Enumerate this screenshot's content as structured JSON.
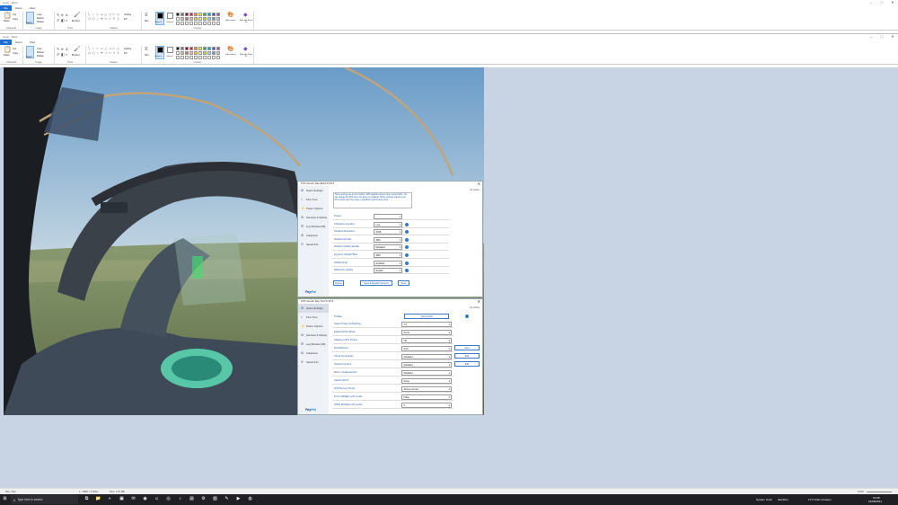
{
  "window1": {
    "title": "Copy - Paint",
    "tabs": [
      "File",
      "Home",
      "View"
    ]
  },
  "window2": {
    "title": "Copy - Paint",
    "tabs": [
      "File",
      "Home",
      "View"
    ]
  },
  "ribbon": {
    "groups": [
      "Clipboard",
      "Image",
      "Tools",
      "Shapes",
      "Colours"
    ],
    "clipboard": {
      "paste": "Paste",
      "cut": "Cut",
      "copy": "Copy"
    },
    "image": {
      "select": "Select",
      "crop": "Crop",
      "resize": "Resize",
      "rotate": "Rotate"
    },
    "tools": {
      "brushes": "Brushes"
    },
    "shapes": {
      "outline": "Outline",
      "fill": "Fill"
    },
    "size": "Size",
    "colour1": "Colour 1",
    "colour2": "Colour 2",
    "edit_colours": "Edit colours",
    "edit_with_paint3d": "Edit with Paint 3D",
    "palette": [
      "#000000",
      "#7f7f7f",
      "#880015",
      "#ed1c24",
      "#ff7f27",
      "#fff200",
      "#22b14c",
      "#00a2e8",
      "#3f48cc",
      "#a349a4",
      "#ffffff",
      "#c3c3c3",
      "#b97a57",
      "#ffaec9",
      "#ffc90e",
      "#efe4b0",
      "#b5e61d",
      "#99d9ea",
      "#7092be",
      "#c8bfe7"
    ]
  },
  "dialog1": {
    "title": "FPS Vendor Ray Build 5715.5",
    "close": "✕",
    "sidebar": [
      "Game Settings",
      "Fine Tune",
      "Power Options",
      "Services & Startup",
      "Log Window (F8)",
      "Advanced",
      "Saved Info"
    ],
    "description": "These settings are for the Nvidia / AMD graphics drivers when using DLSS. You can change the FPS when the game is restarted. Higher settings require more GPU power and may cause a significant performance drop.",
    "version_text": "By Asticle",
    "rows": [
      {
        "label": "Preset",
        "value": ""
      },
      {
        "label": "Character Caustics",
        "value": "Low"
      },
      {
        "label": "Shadow Resolution",
        "value": "2048"
      },
      {
        "label": "Shadow Render",
        "value": "SBC"
      },
      {
        "label": "Shadow Quality Render",
        "value": "Disabled"
      },
      {
        "label": "Dynamic Shader Bias",
        "value": "SBC"
      },
      {
        "label": "Shadowmap",
        "value": "Enabled"
      },
      {
        "label": "Reflection Quality",
        "value": "Enable"
      }
    ],
    "buttons": [
      "Delete",
      "Save & Restart Screens",
      "Save"
    ],
    "paypal_a": "Pay",
    "paypal_b": "Pal"
  },
  "dialog2": {
    "title": "FPS Vendor Ray Tool 5715.5",
    "close": "✕",
    "sidebar": [
      "Game Settings",
      "Fine Tune",
      "Power Options",
      "Services & Startup",
      "Log Window (F8)",
      "Advanced",
      "Saved Info"
    ],
    "version_text": "By Asticle",
    "top_row": {
      "label": "Profiles",
      "button": "View & Edit"
    },
    "rows": [
      {
        "label": "Select Power Scheduling",
        "value": "1.0"
      },
      {
        "label": "Default DX12 Mode",
        "value": "60 Hz"
      },
      {
        "label": "Adaptive GPU Priority",
        "value": "Off"
      },
      {
        "label": "Full Multicore",
        "value": "0.00"
      },
      {
        "label": "Cloud Commands",
        "value": "Disabled"
      },
      {
        "label": "Global Frontiers",
        "value": "Disabled"
      },
      {
        "label": "Mirror Update Events",
        "value": "Disabled"
      },
      {
        "label": "Cache MLCS",
        "value": "None"
      },
      {
        "label": "DXR Server Priority",
        "value": "Above normal"
      },
      {
        "label": "Force MipMap LoD Levels",
        "value": "False"
      },
      {
        "label": "Offset MipMap LoD Levels",
        "value": "0"
      }
    ],
    "side_buttons": [
      "Save",
      "Edit",
      "Edit"
    ],
    "paypal_a": "Pay",
    "paypal_b": "Pal"
  },
  "statusbar": {
    "zoom": "100%",
    "dims": "1 : 3080 × 1725px",
    "size": "Size: 1.67 MB",
    "pos": "562, 79px"
  },
  "taskbar": {
    "search": "Type here to search",
    "tray_a": "System Tools",
    "tray_b": "Sandbox",
    "weather": "17°C  Rain showers",
    "time": "16:08",
    "date": "16/08/2021"
  }
}
